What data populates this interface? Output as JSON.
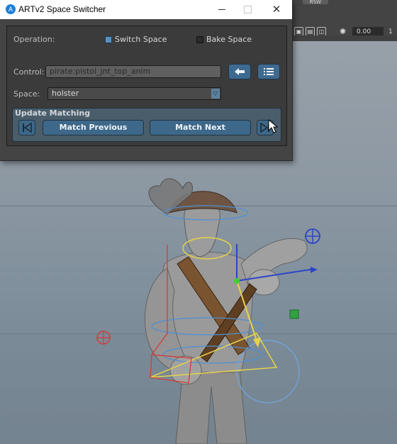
{
  "window": {
    "title": "ARTv2 Space Switcher",
    "operation_label": "Operation:",
    "switch_space_label": "Switch Space",
    "switch_space_checked": true,
    "bake_space_label": "Bake Space",
    "bake_space_checked": false,
    "control_label": "Control:",
    "control_value": "pirate:pistol_jnt_top_anim",
    "space_label": "Space:",
    "space_value": "holster",
    "update_matching_label": "Update Matching",
    "match_previous_label": "Match Previous",
    "match_next_label": "Match Next"
  },
  "viewport": {
    "tab_label": "RSW",
    "field_value": "0.00",
    "field2_value": "1"
  },
  "icons": {
    "app": "artv2-icon",
    "back": "arrow-left-icon",
    "list": "list-icon",
    "first": "skip-first-icon",
    "last": "skip-last-icon"
  },
  "colors": {
    "accent": "#3e6889",
    "window_bg": "#444444",
    "field_bg": "#5f5f5f"
  }
}
